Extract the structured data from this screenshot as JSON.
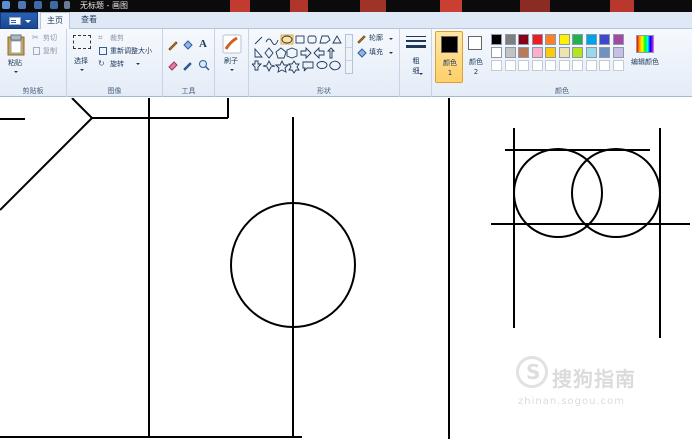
{
  "window": {
    "title": "无标题 - 画图"
  },
  "tabs": [
    {
      "label": "主页",
      "active": true
    },
    {
      "label": "查看",
      "active": false
    }
  ],
  "clipboard": {
    "paste": "粘贴",
    "cut": "剪切",
    "copy": "复制",
    "group": "剪贴板"
  },
  "image": {
    "select": "选择",
    "crop": "裁剪",
    "resize": "重新调整大小",
    "rotate": "旋转",
    "group": "图像"
  },
  "tools": {
    "group": "工具"
  },
  "brush": {
    "label": "刷子"
  },
  "shapes": {
    "outline": "轮廓",
    "fill": "填充",
    "group": "形状"
  },
  "size": {
    "label": "粗细"
  },
  "colors": {
    "color1": "颜色 1",
    "color2": "颜色 2",
    "edit": "编辑颜色",
    "group": "颜色",
    "palette_row1": [
      "#000000",
      "#7f7f7f",
      "#880015",
      "#ed1c24",
      "#ff7f27",
      "#fff200",
      "#22b14c",
      "#00a2e8",
      "#3f48cc",
      "#a349a4"
    ],
    "palette_row2": [
      "#ffffff",
      "#c3c3c3",
      "#b97a57",
      "#ffaec9",
      "#ffc90e",
      "#efe4b0",
      "#b5e61d",
      "#99d9ea",
      "#7092be",
      "#c8bfe7"
    ],
    "palette_row3": [
      "#ffffff",
      "#ffffff",
      "#ffffff",
      "#ffffff",
      "#ffffff",
      "#ffffff",
      "#ffffff",
      "#ffffff",
      "#ffffff",
      "#ffffff"
    ]
  },
  "watermark": {
    "text": "搜狗指南",
    "url": "zhinan.sogou.com"
  }
}
